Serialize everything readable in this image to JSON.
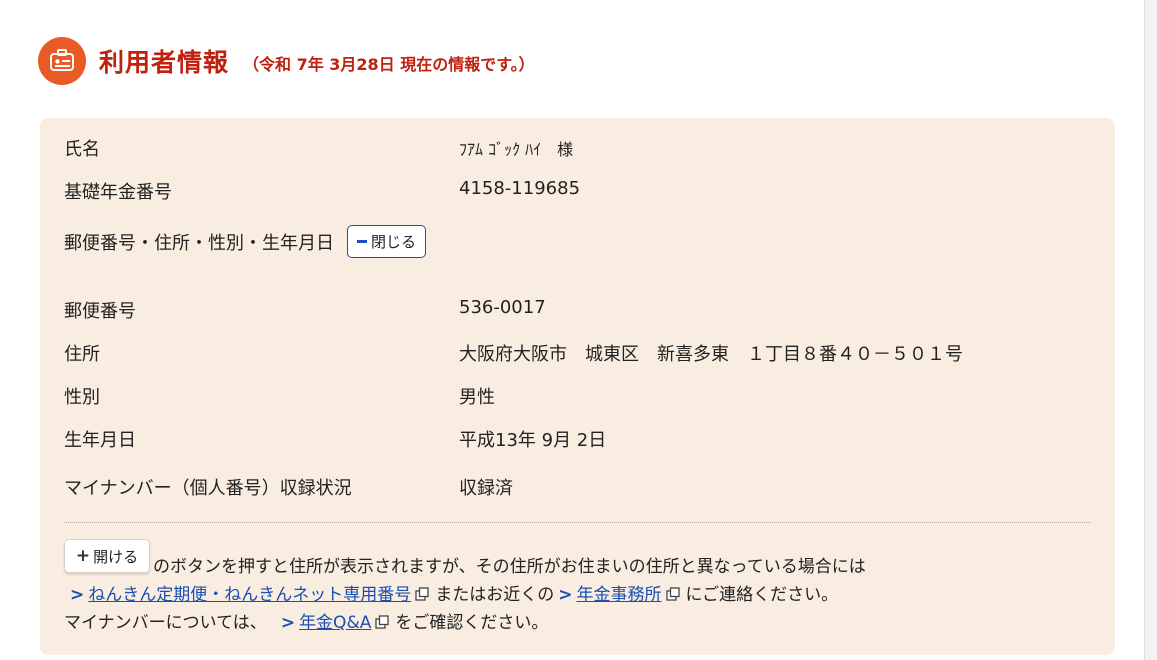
{
  "header": {
    "title": "利用者情報",
    "subtitle": "（令和 7年 3月28日 現在の情報です。）",
    "icon": "id-card-icon",
    "accent_color": "#ea5a24",
    "title_color": "#c0210e"
  },
  "info": {
    "name_label": "氏名",
    "name_value": "ﾌｱﾑ ｺﾞｯｸ ﾊｲ　様",
    "pension_no_label": "基礎年金番号",
    "pension_no_value": "4158-119685",
    "section_label": "郵便番号・住所・性別・生年月日",
    "close_button": "閉じる",
    "postal_label": "郵便番号",
    "postal_value": "536-0017",
    "address_label": "住所",
    "address_value": "大阪府大阪市　城東区　新喜多東　１丁目８番４０－５０１号",
    "gender_label": "性別",
    "gender_value": "男性",
    "birth_label": "生年月日",
    "birth_value": "平成13年 9月 2日",
    "mynumber_label": "マイナンバー（個人番号）収録状況",
    "mynumber_value": "収録済"
  },
  "notes": {
    "open_button": "開ける",
    "line1": "のボタンを押すと住所が表示されますが、その住所がお住まいの住所と異なっている場合には",
    "link1": "ねんきん定期便・ねんきんネット専用番号",
    "mid1": "またはお近くの",
    "link2": "年金事務所",
    "end1": "にご連絡ください。",
    "line3_prefix": "マイナンバーについては、",
    "link3": "年金Q&A",
    "end3": "をご確認ください。"
  },
  "colors": {
    "panel_bg": "#f8ede0",
    "link": "#1a4fb3",
    "button_border": "#1c4fbd"
  }
}
